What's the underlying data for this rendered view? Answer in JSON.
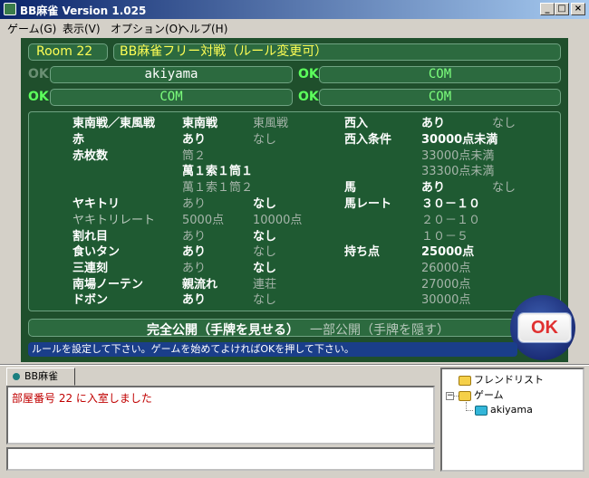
{
  "window": {
    "title": "BB麻雀 Version 1.025",
    "btn_min": "_",
    "btn_max": "□",
    "btn_close": "×"
  },
  "menu": [
    {
      "label": "ゲーム(G)"
    },
    {
      "label": "表示(V)"
    },
    {
      "label": "オプション(O)"
    },
    {
      "label": "ヘルプ(H)"
    }
  ],
  "room": {
    "label": "Room 22",
    "rule_title": "BB麻雀フリー対戦（ルール変更可）"
  },
  "players": [
    {
      "ok": "OK",
      "ok_state": "off",
      "name": "akiyama",
      "color": "#ffffff"
    },
    {
      "ok": "OK",
      "ok_state": "on",
      "name": "COM",
      "color": "#7dff7d"
    },
    {
      "ok": "OK",
      "ok_state": "on",
      "name": "COM",
      "color": "#7dff7d"
    },
    {
      "ok": "OK",
      "ok_state": "on",
      "name": "COM",
      "color": "#7dff7d"
    }
  ],
  "rules": {
    "tonpu_label": "東南戦／東風戦",
    "tonpu_sel": "東南戦",
    "tonpu_unsel": "東風戦",
    "aka_label": "赤",
    "aka_sel": "あり",
    "aka_unsel": "なし",
    "akamai_label": "赤枚数",
    "akamai_opt1": "筒２",
    "akamai_opt2": "萬１索１筒１",
    "akamai_opt3": "萬１索１筒２",
    "yakitori_label": "ヤキトリ",
    "yakitori_unsel": "あり",
    "yakitori_sel": "なし",
    "yakitori_rate_label": "ヤキトリレート",
    "yakitori_rate_1": "5000点",
    "yakitori_rate_2": "10000点",
    "wareme_label": "割れ目",
    "wareme_unsel": "あり",
    "wareme_sel": "なし",
    "kuitan_label": "食いタン",
    "kuitan_sel": "あり",
    "kuitan_unsel": "なし",
    "sanrenko_label": "三連刻",
    "sanrenko_unsel": "あり",
    "sanrenko_sel": "なし",
    "nanba_label": "南場ノーテン",
    "nanba_sel": "親流れ",
    "nanba_unsel": "連荘",
    "dobon_label": "ドボン",
    "dobon_sel": "あり",
    "dobon_unsel": "なし",
    "shanyu_label": "西入",
    "shanyu_sel": "あり",
    "shanyu_unsel": "なし",
    "shanyu_cond_label": "西入条件",
    "shanyu_cond_1": "30000点未満",
    "shanyu_cond_2": "33000点未満",
    "shanyu_cond_3": "33300点未満",
    "uma_label": "馬",
    "uma_sel": "あり",
    "uma_unsel": "なし",
    "uma_rate_label": "馬レート",
    "uma_rate_1": "３０－１０",
    "uma_rate_2": "２０－１０",
    "uma_rate_3": "１０－５",
    "mochiten_label": "持ち点",
    "mochiten_1": "25000点",
    "mochiten_2": "26000点",
    "mochiten_3": "27000点",
    "mochiten_4": "30000点"
  },
  "reveal": {
    "open": "完全公開（手牌を見せる）",
    "partial": "一部公開（手牌を隠す）"
  },
  "ok_button": "OK",
  "status_message": "ルールを設定して下さい。ゲームを始めてよければOKを押して下さい。",
  "chat": {
    "tab_label": "BB麻雀",
    "log": [
      "部屋番号 22 に入室しました"
    ]
  },
  "tree": {
    "friends": "フレンドリスト",
    "game": "ゲーム",
    "user": "akiyama",
    "expander": "−"
  }
}
